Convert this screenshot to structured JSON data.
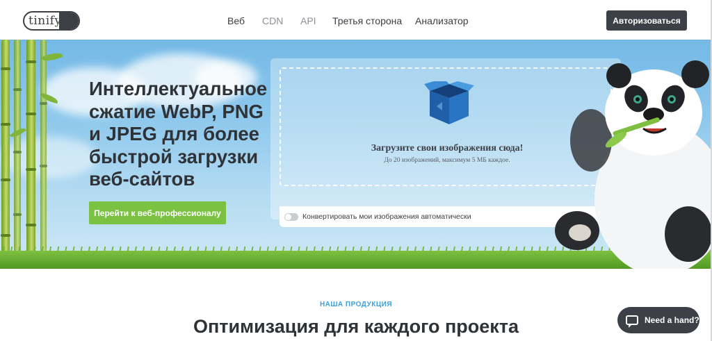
{
  "header": {
    "logo_text": "tinify",
    "nav": [
      {
        "label": "Веб",
        "active": true
      },
      {
        "label": "CDN",
        "active": false
      },
      {
        "label": "API",
        "active": false
      },
      {
        "label": "Третья сторона",
        "active": true
      },
      {
        "label": "Анализатор",
        "active": true
      }
    ],
    "login_label": "Авторизоваться"
  },
  "hero": {
    "headline": "Интеллектуальное сжатие WebP, PNG и JPEG для более быстрой загрузки веб-сайтов",
    "cta_label": "Перейти к веб-профессионалу"
  },
  "upload": {
    "title": "Загрузите свои изображения сюда!",
    "subtitle": "До 20 изображений, максимум 5 МБ каждое.",
    "convert_label": "Конвертировать мои изображения автоматически",
    "convert_enabled": false
  },
  "products": {
    "kicker": "НАША ПРОДУКЦИЯ",
    "title": "Оптимизация для каждого проекта"
  },
  "help": {
    "label": "Need a hand?"
  },
  "colors": {
    "accent_green": "#7cc242",
    "dark": "#3d4046",
    "kicker_blue": "#3f9fd8"
  }
}
